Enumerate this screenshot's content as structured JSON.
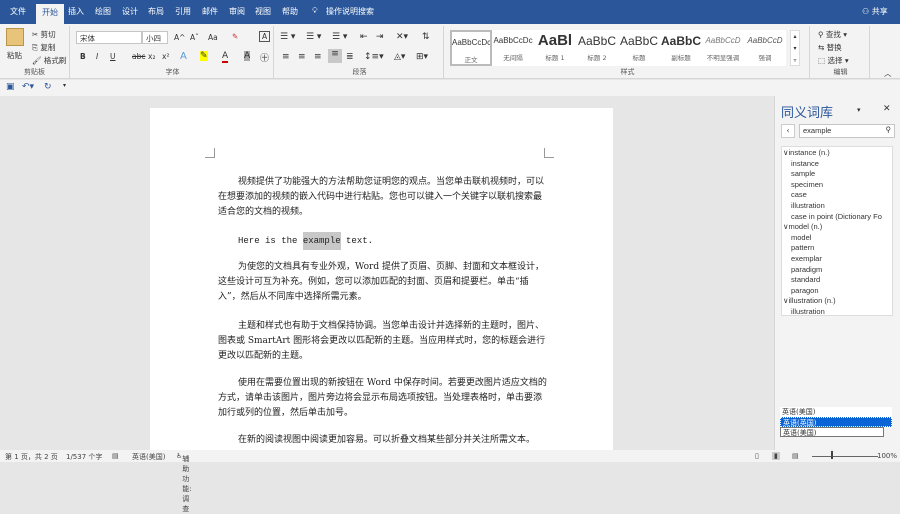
{
  "tabs": [
    "文件",
    "开始",
    "插入",
    "绘图",
    "设计",
    "布局",
    "引用",
    "邮件",
    "审阅",
    "视图",
    "帮助"
  ],
  "tell_me": "操作说明搜索",
  "share": "共享",
  "clipboard": {
    "paste": "粘贴",
    "cut": "剪切",
    "copy": "复制",
    "format_painter": "格式刷",
    "label": "剪贴板"
  },
  "font": {
    "name": "宋体",
    "size": "小四",
    "label": "字体",
    "bold": "B",
    "italic": "I",
    "underline": "U",
    "strike": "abc",
    "sub": "x₂",
    "sup": "x²",
    "grow": "A^",
    "shrink": "Aˇ",
    "case": "Aa"
  },
  "paragraph": {
    "label": "段落"
  },
  "styles": {
    "label": "样式",
    "items": [
      {
        "preview": "AaBbCcDc",
        "name": "正文"
      },
      {
        "preview": "AaBbCcDc",
        "name": "无间隔"
      },
      {
        "preview": "AaBl",
        "name": "标题 1"
      },
      {
        "preview": "AaBbC",
        "name": "标题 2"
      },
      {
        "preview": "AaBbC",
        "name": "标题"
      },
      {
        "preview": "AaBbC",
        "name": "副标题"
      },
      {
        "preview": "AaBbCcD",
        "name": "不明显强调"
      },
      {
        "preview": "AaBbCcD",
        "name": "强调"
      }
    ]
  },
  "editing": {
    "find": "查找",
    "replace": "替换",
    "select": "选择",
    "label": "编辑"
  },
  "document": {
    "p1": "视频提供了功能强大的方法帮助您证明您的观点。当您单击联机视频时，可以在想要添加的视频的嵌入代码中进行粘贴。您也可以键入一个关键字以联机搜索最适合您的文档的视频。",
    "p2_before": "Here is the ",
    "p2_sel": "example",
    "p2_after": " text.",
    "p3": "为使您的文档具有专业外观，Word 提供了页眉、页脚、封面和文本框设计，这些设计可互为补充。例如，您可以添加匹配的封面、页眉和提要栏。单击“插入”，然后从不同库中选择所需元素。",
    "p4": "主题和样式也有助于文档保持协调。当您单击设计并选择新的主题时，图片、图表或 SmartArt 图形将会更改以匹配新的主题。当应用样式时，您的标题会进行更改以匹配新的主题。",
    "p5": "使用在需要位置出现的新按钮在 Word 中保存时间。若要更改图片适应文档的方式，请单击该图片，图片旁边将会显示布局选项按钮。当处理表格时，单击要添加行或列的位置，然后单击加号。",
    "p6": "在新的阅读视图中阅读更加容易。可以折叠文档某些部分并关注所需文本。"
  },
  "thesaurus": {
    "title": "同义词库",
    "search": "example",
    "groups": [
      {
        "head": "instance (n.)",
        "items": [
          "instance",
          "sample",
          "specimen",
          "case",
          "illustration",
          "case in point (Dictionary Fo"
        ]
      },
      {
        "head": "model (n.)",
        "items": [
          "model",
          "pattern",
          "exemplar",
          "paradigm",
          "standard",
          "paragon"
        ]
      },
      {
        "head": "illustration (n.)",
        "items": [
          "illustration"
        ]
      }
    ]
  },
  "language_dropdown": [
    "英语(美国)",
    "英语(英国)",
    "英语(美国)"
  ],
  "status": {
    "page": "第 1 页，共 2 页",
    "words": "1/537 个字",
    "language": "英语(美国)",
    "accessibility": "辅助功能: 调查",
    "zoom": "100%"
  }
}
